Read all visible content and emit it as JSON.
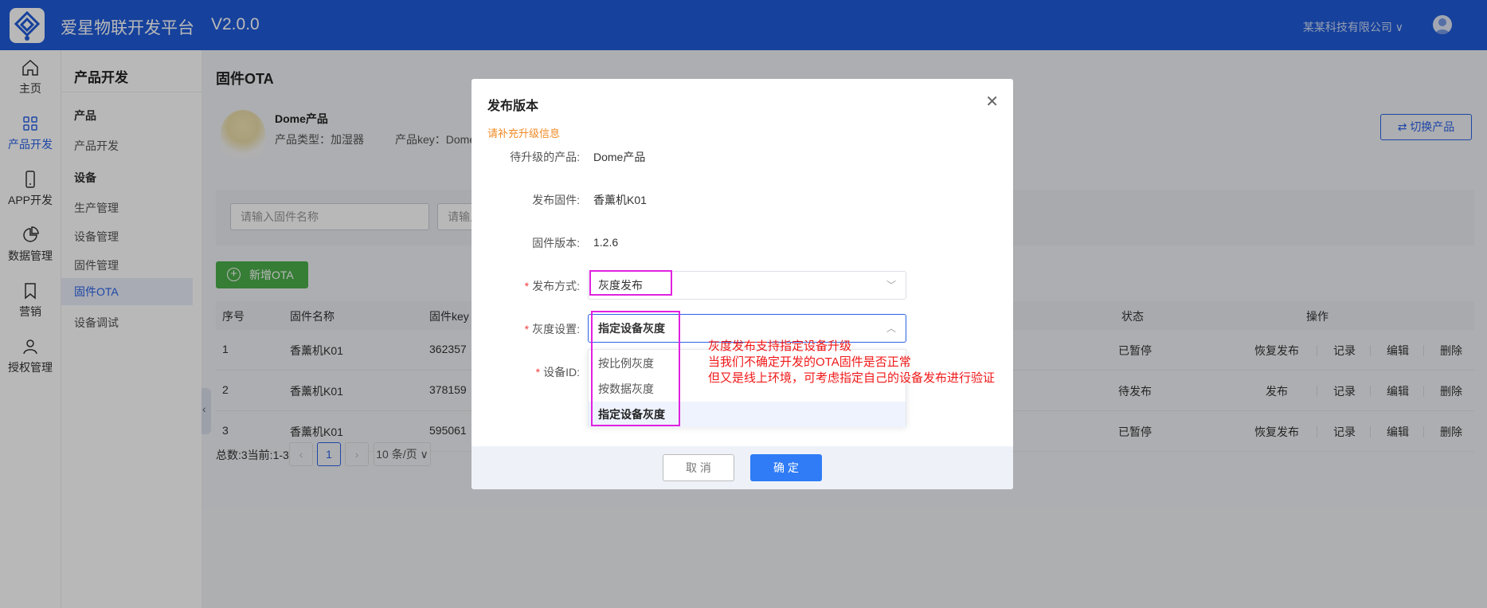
{
  "header": {
    "app_title": "爱星物联开发平台",
    "version": "V2.0.0",
    "company": "某某科技有限公司 ∨"
  },
  "rail": {
    "items": [
      {
        "label": "主页",
        "icon": "home-icon"
      },
      {
        "label": "产品开发",
        "icon": "grid-icon",
        "active": true
      },
      {
        "label": "APP开发",
        "icon": "phone-icon"
      },
      {
        "label": "数据管理",
        "icon": "pie-chart-icon"
      },
      {
        "label": "营销",
        "icon": "bookmark-icon"
      },
      {
        "label": "授权管理",
        "icon": "user-icon"
      }
    ]
  },
  "submenu": {
    "title": "产品开发",
    "group_product": "产品",
    "product_dev": "产品开发",
    "group_device": "设备",
    "items": [
      "生产管理",
      "设备管理",
      "固件管理",
      "固件OTA",
      "设备调试"
    ]
  },
  "main": {
    "page_title": "固件OTA",
    "product_name": "Dome产品",
    "product_type": "产品类型：加湿器",
    "product_key": "产品key：Dome",
    "switch_label": "切换产品",
    "filter_placeholder_1": "请输入固件名称",
    "filter_placeholder_2": "请输入",
    "add_label": "新增OTA",
    "columns": {
      "no": "序号",
      "name": "固件名称",
      "key": "固件key",
      "status": "状态",
      "ops": "操作"
    },
    "rows": [
      {
        "no": "1",
        "name": "香薰机K01",
        "key": "362357",
        "status": "已暂停",
        "op1": "恢复发布",
        "op2": "记录",
        "op3": "编辑",
        "op4": "删除"
      },
      {
        "no": "2",
        "name": "香薰机K01",
        "key": "378159",
        "status": "待发布",
        "op1": "发布",
        "op2": "记录",
        "op3": "编辑",
        "op4": "删除"
      },
      {
        "no": "3",
        "name": "香薰机K01",
        "key": "595061",
        "status": "已暂停",
        "op1": "恢复发布",
        "op2": "记录",
        "op3": "编辑",
        "op4": "删除"
      }
    ],
    "pager": {
      "summary": "总数:3当前:1-3",
      "current": "1",
      "page_size": "10 条/页 ∨"
    }
  },
  "modal": {
    "title": "发布版本",
    "hint": "请补充升级信息",
    "fields": {
      "product_label": "待升级的产品:",
      "product_value": "Dome产品",
      "firmware_label": "发布固件:",
      "firmware_value": "香薰机K01",
      "version_label": "固件版本:",
      "version_value": "1.2.6",
      "method_label": "发布方式:",
      "method_value": "灰度发布",
      "gray_label": "灰度设置:",
      "gray_value": "指定设备灰度",
      "device_label": "设备ID:"
    },
    "dropdown": [
      "按比例灰度",
      "按数据灰度",
      "指定设备灰度"
    ],
    "cancel": "取 消",
    "ok": "确 定"
  },
  "annotation": {
    "lines": [
      "灰度发布支持指定设备升级",
      "当我们不确定开发的OTA固件是否正常",
      "但又是线上环境，可考虑指定自己的设备发布进行验证"
    ]
  },
  "colors": {
    "primary": "#1f5bd8",
    "link": "#2a62e8",
    "success": "#4cae4c",
    "highlight": "#e021e0",
    "annotation": "#f01818"
  }
}
